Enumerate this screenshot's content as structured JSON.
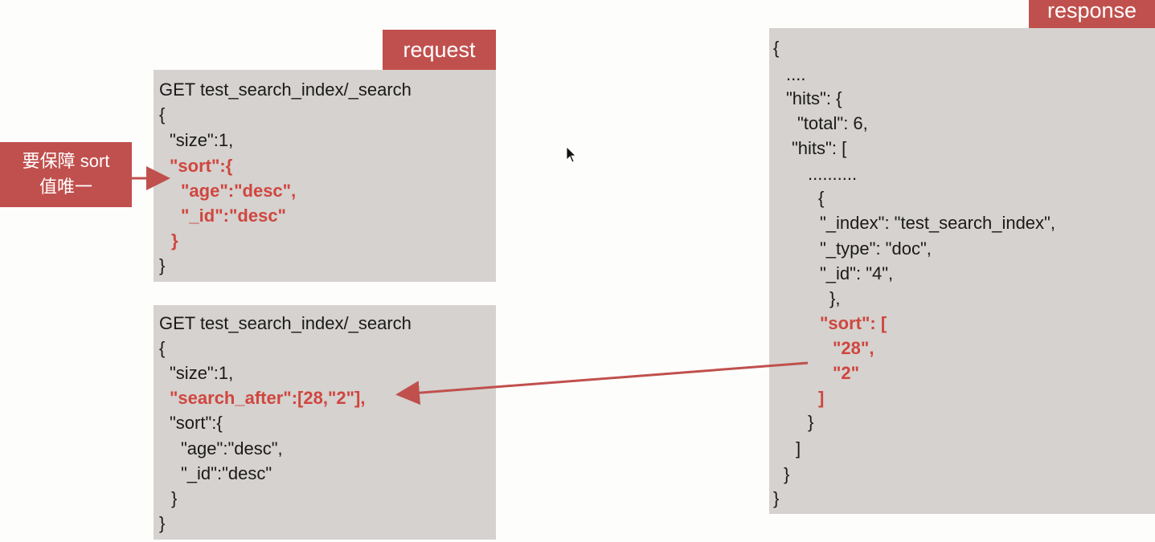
{
  "request_label": "request",
  "response_label": "response",
  "callout": {
    "line1": "要保障 sort",
    "line2": "值唯一"
  },
  "request1": [
    "GET test_search_index/_search",
    "{",
    "\"size\":1,",
    "\"sort\":{",
    "\"age\":\"desc\",",
    "\"_id\":\"desc\"",
    "}",
    "}"
  ],
  "request2": [
    "GET test_search_index/_search",
    "{",
    "\"size\":1,",
    "\"search_after\":[28,\"2\"],",
    "\"sort\":{",
    "\"age\":\"desc\",",
    "\"_id\":\"desc\"",
    "}",
    "}"
  ],
  "response": [
    "{",
    "....",
    "\"hits\": {",
    "\"total\": 6,",
    "\"hits\": [",
    "..........",
    "{",
    "\"_index\": \"test_search_index\",",
    "\"_type\": \"doc\",",
    "\"_id\": \"4\",",
    "},",
    "\"sort\": [",
    "\"28\",",
    "\"2\"",
    "]",
    "}",
    "]",
    "}",
    "}"
  ],
  "colors": {
    "accent": "#c0504d",
    "code_bg": "#d5d2cf",
    "highlight": "#d0463f"
  }
}
